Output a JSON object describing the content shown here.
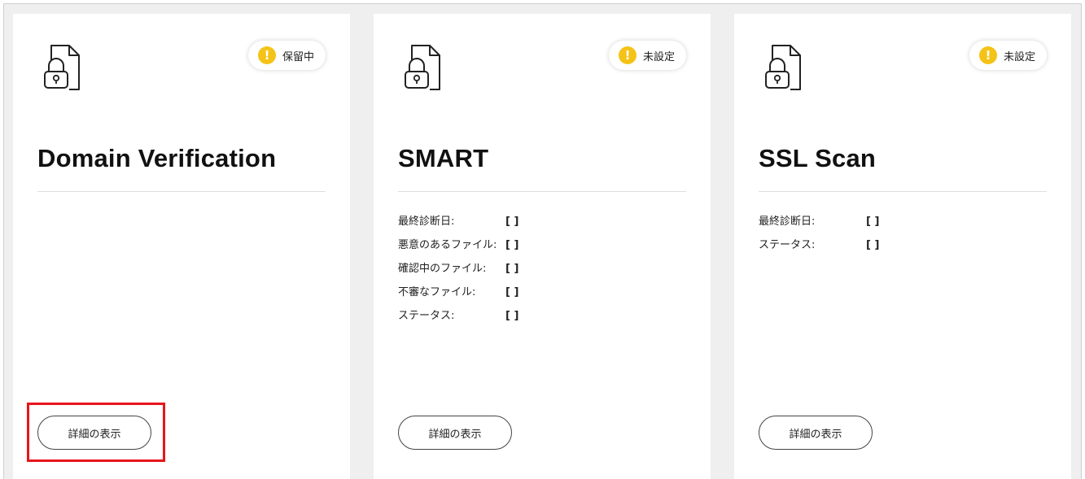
{
  "colors": {
    "page_background": "#efefef",
    "card_background": "#ffffff",
    "badge_dot": "#f5c318",
    "highlight": "#e8141c"
  },
  "cards": [
    {
      "icon": "locked-document-icon",
      "badge_label": "保留中",
      "badge_icon": "exclamation-icon",
      "title": "Domain Verification",
      "fields": [],
      "button_label": "詳細の表示"
    },
    {
      "icon": "locked-document-icon",
      "badge_label": "未設定",
      "badge_icon": "exclamation-icon",
      "title": "SMART",
      "fields": [
        {
          "label": "最終診断日:",
          "value": "[ ]"
        },
        {
          "label": "悪意のあるファイル:",
          "value": "[ ]"
        },
        {
          "label": "確認中のファイル:",
          "value": "[ ]"
        },
        {
          "label": "不審なファイル:",
          "value": "[ ]"
        },
        {
          "label": "ステータス:",
          "value": "[ ]"
        }
      ],
      "button_label": "詳細の表示"
    },
    {
      "icon": "locked-document-icon",
      "badge_label": "未設定",
      "badge_icon": "exclamation-icon",
      "title": "SSL Scan",
      "fields": [
        {
          "label": "最終診断日:",
          "value": "[ ]"
        },
        {
          "label": "ステータス:",
          "value": "[ ]"
        }
      ],
      "button_label": "詳細の表示"
    }
  ]
}
